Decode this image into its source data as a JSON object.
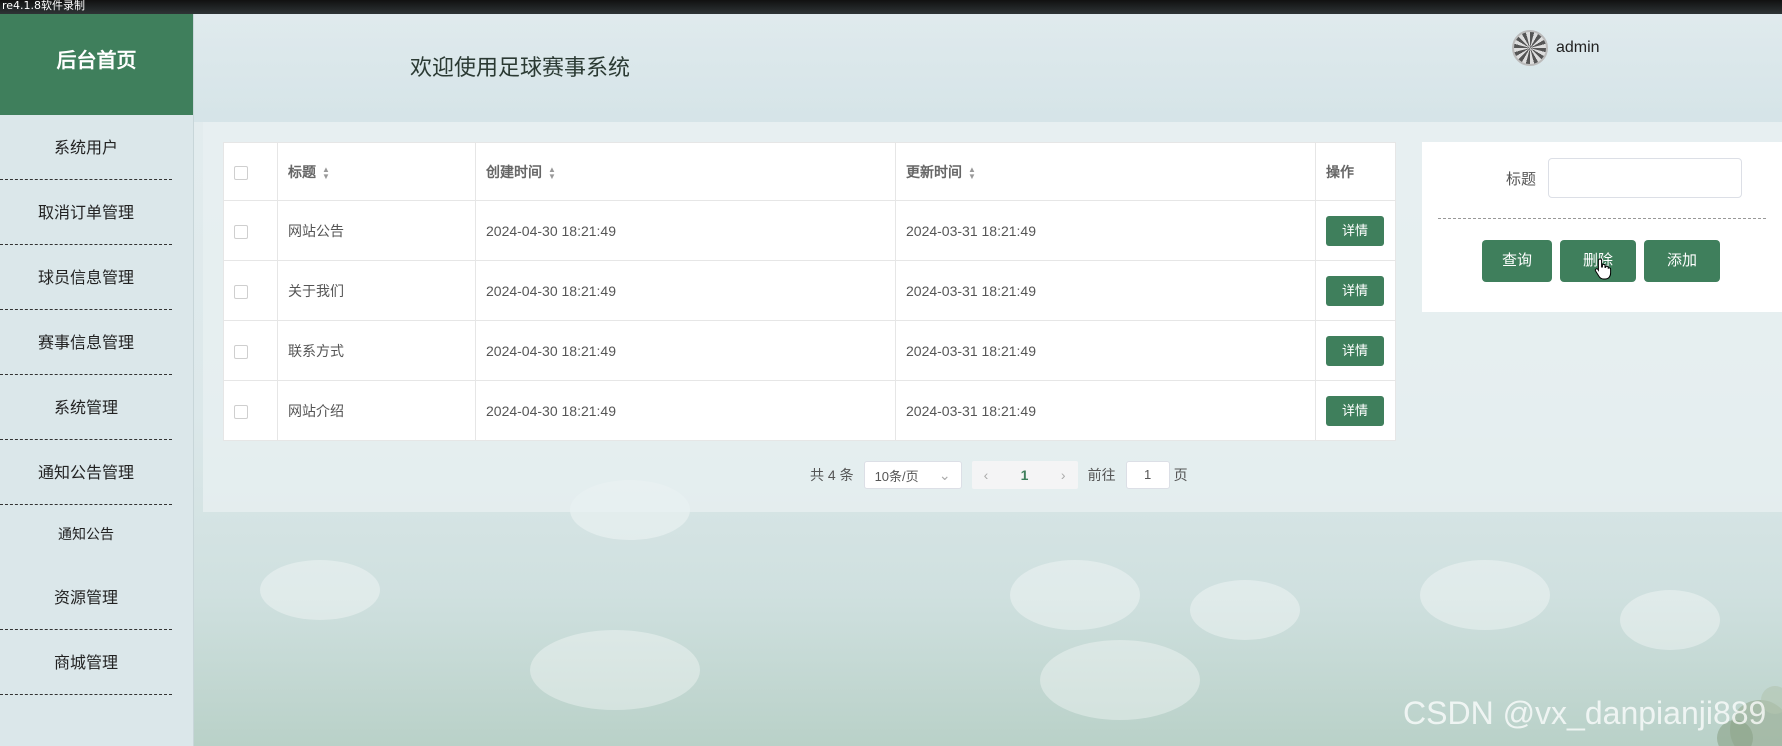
{
  "top_strip_text": "re4.1.8软件录制",
  "sidebar": {
    "brand": "后台首页",
    "items": [
      {
        "label": "系统用户"
      },
      {
        "label": "取消订单管理"
      },
      {
        "label": "球员信息管理"
      },
      {
        "label": "赛事信息管理"
      },
      {
        "label": "系统管理"
      },
      {
        "label": "通知公告管理"
      },
      {
        "label": "通知公告"
      },
      {
        "label": "资源管理"
      },
      {
        "label": "商城管理"
      }
    ]
  },
  "header": {
    "welcome": "欢迎使用足球赛事系统",
    "username": "admin"
  },
  "table": {
    "columns": [
      "标题",
      "创建时间",
      "更新时间",
      "操作"
    ],
    "detail_label": "详情",
    "rows": [
      {
        "title": "网站公告",
        "created": "2024-04-30 18:21:49",
        "updated": "2024-03-31 18:21:49"
      },
      {
        "title": "关于我们",
        "created": "2024-04-30 18:21:49",
        "updated": "2024-03-31 18:21:49"
      },
      {
        "title": "联系方式",
        "created": "2024-04-30 18:21:49",
        "updated": "2024-03-31 18:21:49"
      },
      {
        "title": "网站介绍",
        "created": "2024-04-30 18:21:49",
        "updated": "2024-03-31 18:21:49"
      }
    ]
  },
  "pagination": {
    "total": "共 4 条",
    "page_size": "10条/页",
    "current_page": "1",
    "goto_prefix": "前往",
    "goto_value": "1",
    "goto_suffix": "页"
  },
  "search": {
    "label": "标题",
    "input_value": "",
    "buttons": {
      "query": "查询",
      "delete": "删除",
      "add": "添加"
    }
  },
  "watermark": "CSDN @vx_danpianji889",
  "colors": {
    "primary": "#3f7f5c"
  }
}
